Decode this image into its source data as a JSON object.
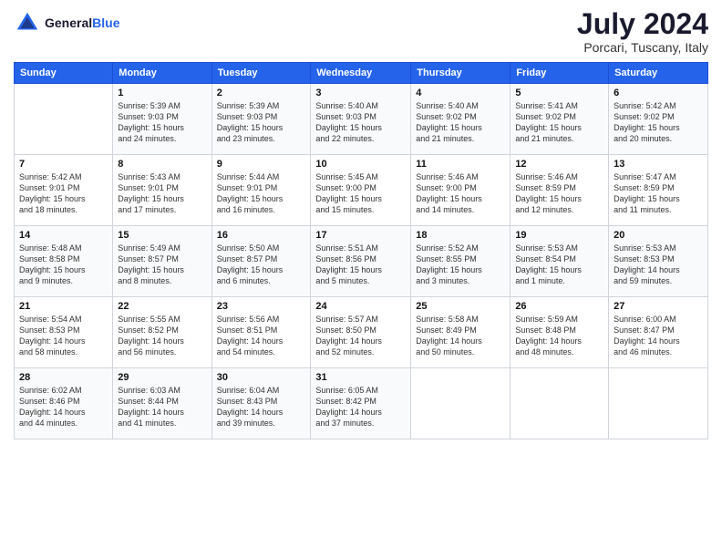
{
  "header": {
    "logo_line1": "General",
    "logo_line2": "Blue",
    "month_year": "July 2024",
    "location": "Porcari, Tuscany, Italy"
  },
  "weekdays": [
    "Sunday",
    "Monday",
    "Tuesday",
    "Wednesday",
    "Thursday",
    "Friday",
    "Saturday"
  ],
  "weeks": [
    [
      {
        "day": "",
        "info": ""
      },
      {
        "day": "1",
        "info": "Sunrise: 5:39 AM\nSunset: 9:03 PM\nDaylight: 15 hours\nand 24 minutes."
      },
      {
        "day": "2",
        "info": "Sunrise: 5:39 AM\nSunset: 9:03 PM\nDaylight: 15 hours\nand 23 minutes."
      },
      {
        "day": "3",
        "info": "Sunrise: 5:40 AM\nSunset: 9:03 PM\nDaylight: 15 hours\nand 22 minutes."
      },
      {
        "day": "4",
        "info": "Sunrise: 5:40 AM\nSunset: 9:02 PM\nDaylight: 15 hours\nand 21 minutes."
      },
      {
        "day": "5",
        "info": "Sunrise: 5:41 AM\nSunset: 9:02 PM\nDaylight: 15 hours\nand 21 minutes."
      },
      {
        "day": "6",
        "info": "Sunrise: 5:42 AM\nSunset: 9:02 PM\nDaylight: 15 hours\nand 20 minutes."
      }
    ],
    [
      {
        "day": "7",
        "info": "Sunrise: 5:42 AM\nSunset: 9:01 PM\nDaylight: 15 hours\nand 18 minutes."
      },
      {
        "day": "8",
        "info": "Sunrise: 5:43 AM\nSunset: 9:01 PM\nDaylight: 15 hours\nand 17 minutes."
      },
      {
        "day": "9",
        "info": "Sunrise: 5:44 AM\nSunset: 9:01 PM\nDaylight: 15 hours\nand 16 minutes."
      },
      {
        "day": "10",
        "info": "Sunrise: 5:45 AM\nSunset: 9:00 PM\nDaylight: 15 hours\nand 15 minutes."
      },
      {
        "day": "11",
        "info": "Sunrise: 5:46 AM\nSunset: 9:00 PM\nDaylight: 15 hours\nand 14 minutes."
      },
      {
        "day": "12",
        "info": "Sunrise: 5:46 AM\nSunset: 8:59 PM\nDaylight: 15 hours\nand 12 minutes."
      },
      {
        "day": "13",
        "info": "Sunrise: 5:47 AM\nSunset: 8:59 PM\nDaylight: 15 hours\nand 11 minutes."
      }
    ],
    [
      {
        "day": "14",
        "info": "Sunrise: 5:48 AM\nSunset: 8:58 PM\nDaylight: 15 hours\nand 9 minutes."
      },
      {
        "day": "15",
        "info": "Sunrise: 5:49 AM\nSunset: 8:57 PM\nDaylight: 15 hours\nand 8 minutes."
      },
      {
        "day": "16",
        "info": "Sunrise: 5:50 AM\nSunset: 8:57 PM\nDaylight: 15 hours\nand 6 minutes."
      },
      {
        "day": "17",
        "info": "Sunrise: 5:51 AM\nSunset: 8:56 PM\nDaylight: 15 hours\nand 5 minutes."
      },
      {
        "day": "18",
        "info": "Sunrise: 5:52 AM\nSunset: 8:55 PM\nDaylight: 15 hours\nand 3 minutes."
      },
      {
        "day": "19",
        "info": "Sunrise: 5:53 AM\nSunset: 8:54 PM\nDaylight: 15 hours\nand 1 minute."
      },
      {
        "day": "20",
        "info": "Sunrise: 5:53 AM\nSunset: 8:53 PM\nDaylight: 14 hours\nand 59 minutes."
      }
    ],
    [
      {
        "day": "21",
        "info": "Sunrise: 5:54 AM\nSunset: 8:53 PM\nDaylight: 14 hours\nand 58 minutes."
      },
      {
        "day": "22",
        "info": "Sunrise: 5:55 AM\nSunset: 8:52 PM\nDaylight: 14 hours\nand 56 minutes."
      },
      {
        "day": "23",
        "info": "Sunrise: 5:56 AM\nSunset: 8:51 PM\nDaylight: 14 hours\nand 54 minutes."
      },
      {
        "day": "24",
        "info": "Sunrise: 5:57 AM\nSunset: 8:50 PM\nDaylight: 14 hours\nand 52 minutes."
      },
      {
        "day": "25",
        "info": "Sunrise: 5:58 AM\nSunset: 8:49 PM\nDaylight: 14 hours\nand 50 minutes."
      },
      {
        "day": "26",
        "info": "Sunrise: 5:59 AM\nSunset: 8:48 PM\nDaylight: 14 hours\nand 48 minutes."
      },
      {
        "day": "27",
        "info": "Sunrise: 6:00 AM\nSunset: 8:47 PM\nDaylight: 14 hours\nand 46 minutes."
      }
    ],
    [
      {
        "day": "28",
        "info": "Sunrise: 6:02 AM\nSunset: 8:46 PM\nDaylight: 14 hours\nand 44 minutes."
      },
      {
        "day": "29",
        "info": "Sunrise: 6:03 AM\nSunset: 8:44 PM\nDaylight: 14 hours\nand 41 minutes."
      },
      {
        "day": "30",
        "info": "Sunrise: 6:04 AM\nSunset: 8:43 PM\nDaylight: 14 hours\nand 39 minutes."
      },
      {
        "day": "31",
        "info": "Sunrise: 6:05 AM\nSunset: 8:42 PM\nDaylight: 14 hours\nand 37 minutes."
      },
      {
        "day": "",
        "info": ""
      },
      {
        "day": "",
        "info": ""
      },
      {
        "day": "",
        "info": ""
      }
    ]
  ]
}
